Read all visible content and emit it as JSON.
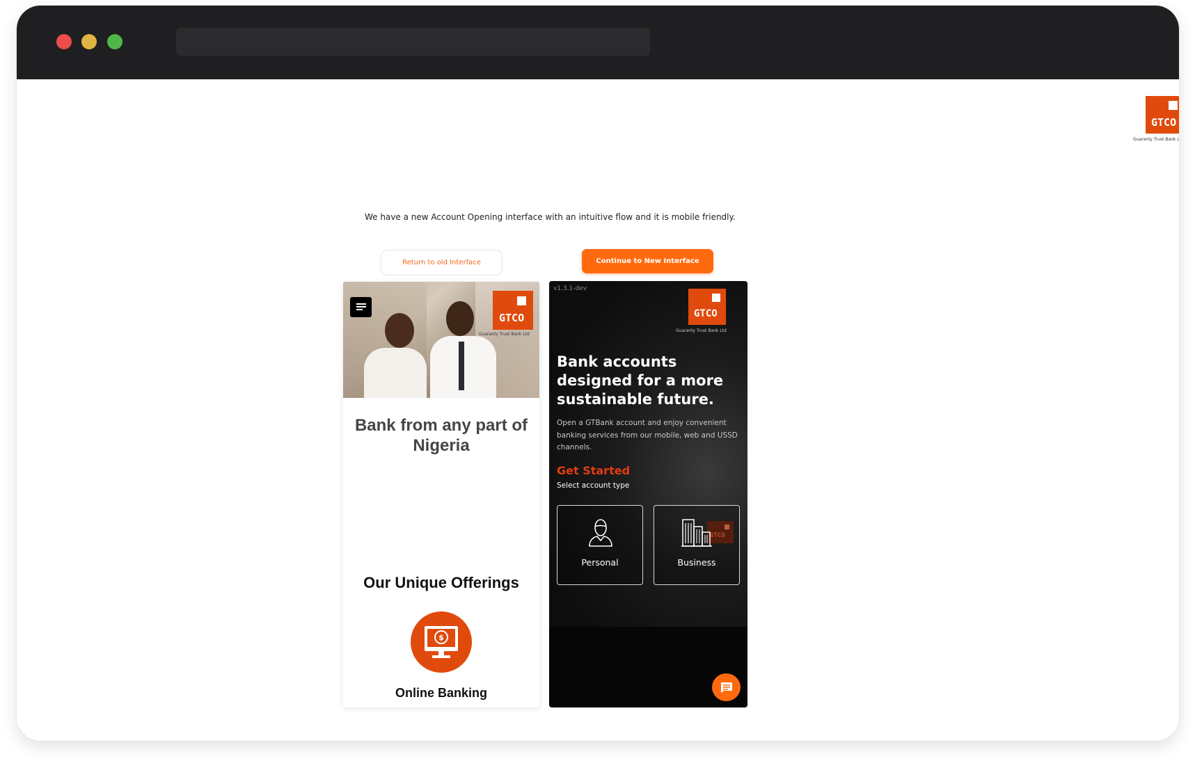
{
  "brand": {
    "logo_text": "GTCO",
    "logo_subtitle": "Guaranty Trust Bank Ltd",
    "accent_color": "#e04a0c",
    "button_color": "#ff6a0e"
  },
  "notice": {
    "text": "We have a new Account Opening interface with an intuitive flow and it is mobile friendly."
  },
  "buttons": {
    "return_old": "Return to old Interface",
    "continue_new": "Continue to New Interface"
  },
  "old_interface": {
    "menu_icon": "hamburger-menu-icon",
    "headline": "Bank from any part of Nigeria",
    "offerings_title": "Our Unique Offerings",
    "offering_icon": "online-banking-monitor-icon",
    "offering_label": "Online Banking"
  },
  "new_interface": {
    "version": "v1.3.1-dev",
    "headline": "Bank accounts designed for a more sustainable future.",
    "description": "Open a GTBank account and enjoy convenient banking services from our mobile, web and USSD channels.",
    "get_started": "Get Started",
    "select_label": "Select account type",
    "account_types": [
      {
        "label": "Personal",
        "icon": "person-icon"
      },
      {
        "label": "Business",
        "icon": "buildings-icon"
      }
    ],
    "chat_icon": "chat-icon"
  }
}
